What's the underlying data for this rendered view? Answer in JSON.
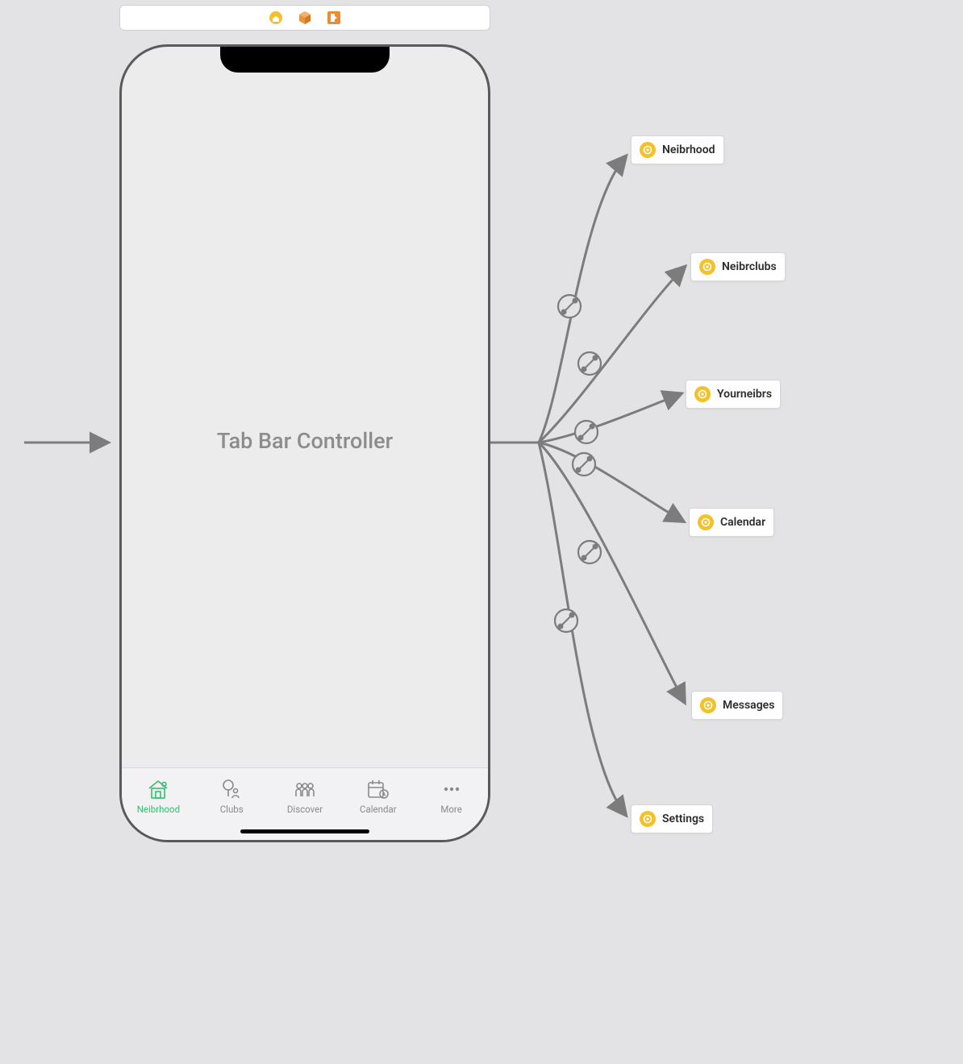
{
  "toolbar": {
    "icons": [
      "storyboard-home",
      "cube-3d",
      "exit-scene"
    ]
  },
  "phone": {
    "title": "Tab Bar Controller",
    "tabs": [
      {
        "label": "Neibrhood",
        "active": true
      },
      {
        "label": "Clubs",
        "active": false
      },
      {
        "label": "Discover",
        "active": false
      },
      {
        "label": "Calendar",
        "active": false
      },
      {
        "label": "More",
        "active": false
      }
    ]
  },
  "destinations": [
    {
      "label": "Neibrhood"
    },
    {
      "label": "Neibrclubs"
    },
    {
      "label": "Yourneibrs"
    },
    {
      "label": "Calendar"
    },
    {
      "label": "Messages"
    },
    {
      "label": "Settings"
    }
  ]
}
